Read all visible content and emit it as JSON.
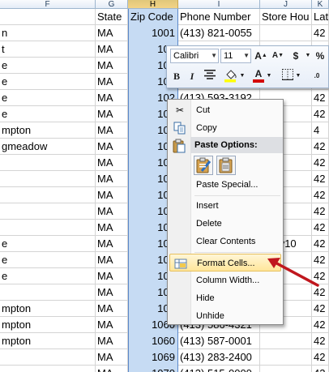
{
  "columns": {
    "F": "F",
    "G": "G",
    "H": "H",
    "I": "I",
    "J": "J",
    "K": "K"
  },
  "header_row": {
    "state": "State",
    "zip": "Zip Code",
    "phone": "Phone Number",
    "store_hours": "Store Hou",
    "lat": "Lat"
  },
  "rows": [
    {
      "f": "n",
      "g": "MA",
      "h": "1001",
      "i": "(413) 821-0055",
      "j": "",
      "k": "42"
    },
    {
      "f": "t",
      "g": "MA",
      "h": "100",
      "i": "",
      "j": "",
      "k": "42"
    },
    {
      "f": "e",
      "g": "MA",
      "h": "102",
      "i": "",
      "j": "",
      "k": "42"
    },
    {
      "f": "e",
      "g": "MA",
      "h": "102",
      "i": "",
      "j": "",
      "k": "42"
    },
    {
      "f": "e",
      "g": "MA",
      "h": "102",
      "i": "(413) 593-3192",
      "j": "",
      "k": "42"
    },
    {
      "f": "e",
      "g": "MA",
      "h": "102",
      "i": "",
      "j": "",
      "k": "42"
    },
    {
      "f": "mpton",
      "g": "MA",
      "h": "102",
      "i": "",
      "j": "",
      "k": "4"
    },
    {
      "f": "gmeadow",
      "g": "MA",
      "h": "102",
      "i": "",
      "j": "",
      "k": "42"
    },
    {
      "f": "",
      "g": "MA",
      "h": "103",
      "i": "",
      "j": "",
      "k": "42"
    },
    {
      "f": "",
      "g": "MA",
      "h": "103",
      "i": "",
      "j": "",
      "k": "42"
    },
    {
      "f": "",
      "g": "MA",
      "h": "103",
      "i": "",
      "j": "",
      "k": "42"
    },
    {
      "f": "",
      "g": "MA",
      "h": "103",
      "i": "",
      "j": "",
      "k": "42"
    },
    {
      "f": "",
      "g": "MA",
      "h": "103",
      "i": "",
      "j": "",
      "k": "42"
    },
    {
      "f": "e",
      "g": "MA",
      "h": "104",
      "i": "",
      "j": "nday10",
      "k": "42"
    },
    {
      "f": "e",
      "g": "MA",
      "h": "104",
      "i": "",
      "j": "",
      "k": "42"
    },
    {
      "f": "e",
      "g": "MA",
      "h": "104",
      "i": "",
      "j": "",
      "k": "42"
    },
    {
      "f": "",
      "g": "MA",
      "h": "105",
      "i": "",
      "j": "",
      "k": "42"
    },
    {
      "f": "mpton",
      "g": "MA",
      "h": "106",
      "i": "",
      "j": "",
      "k": "42"
    },
    {
      "f": "mpton",
      "g": "MA",
      "h": "1060",
      "i": "(413) 586-4321",
      "j": "",
      "k": "42"
    },
    {
      "f": "mpton",
      "g": "MA",
      "h": "1060",
      "i": "(413) 587-0001",
      "j": "",
      "k": "42"
    },
    {
      "f": "",
      "g": "MA",
      "h": "1069",
      "i": "(413) 283-2400",
      "j": "",
      "k": "42"
    },
    {
      "f": "",
      "g": "MA",
      "h": "1070",
      "i": "(413) 515-0000",
      "j": "",
      "k": "42"
    }
  ],
  "mini_toolbar": {
    "font_name": "Calibri",
    "font_size": "11",
    "grow_font": "A",
    "shrink_font": "A",
    "currency": "$",
    "percent": "%",
    "bold": "B",
    "italic": "I",
    "font_color_letter": "A",
    "accent_fill": "#ffff00",
    "accent_font": "#d40000"
  },
  "context_menu": {
    "cut": "Cut",
    "copy": "Copy",
    "paste_options": "Paste Options:",
    "paste_special": "Paste Special...",
    "insert": "Insert",
    "delete": "Delete",
    "clear_contents": "Clear Contents",
    "format_cells": "Format Cells...",
    "column_width": "Column Width...",
    "hide": "Hide",
    "unhide": "Unhide"
  },
  "colors": {
    "selection": "#c6dbf3",
    "highlight": "#ffe69a",
    "arrow": "#c0171e"
  }
}
